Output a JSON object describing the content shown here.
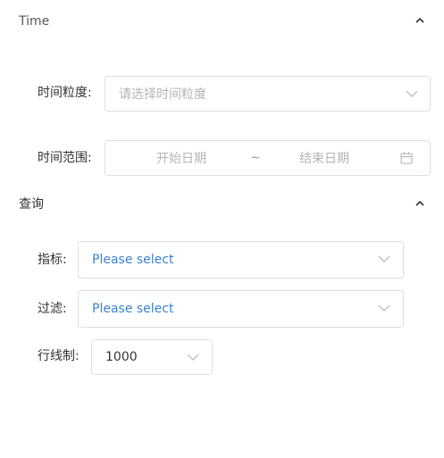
{
  "sections": {
    "time": {
      "title": "Time",
      "granularity": {
        "label": "时间粒度:",
        "placeholder": "请选择时间粒度"
      },
      "range": {
        "label": "时间范围:",
        "start_placeholder": "开始日期",
        "separator": "~",
        "end_placeholder": "结束日期"
      }
    },
    "query": {
      "title": "查询",
      "metrics": {
        "label": "指标:",
        "placeholder": "Please select"
      },
      "filter": {
        "label": "过滤:",
        "placeholder": "Please select"
      },
      "row_limit": {
        "label": "行线制:",
        "value": "1000"
      }
    }
  },
  "colors": {
    "placeholder_gray": "#b4b4b4",
    "placeholder_blue": "#3b82d0",
    "border": "#dcdfe6"
  },
  "icons": {
    "collapse": "chevron-up-icon",
    "dropdown": "chevron-down-icon",
    "date": "calendar-icon"
  }
}
